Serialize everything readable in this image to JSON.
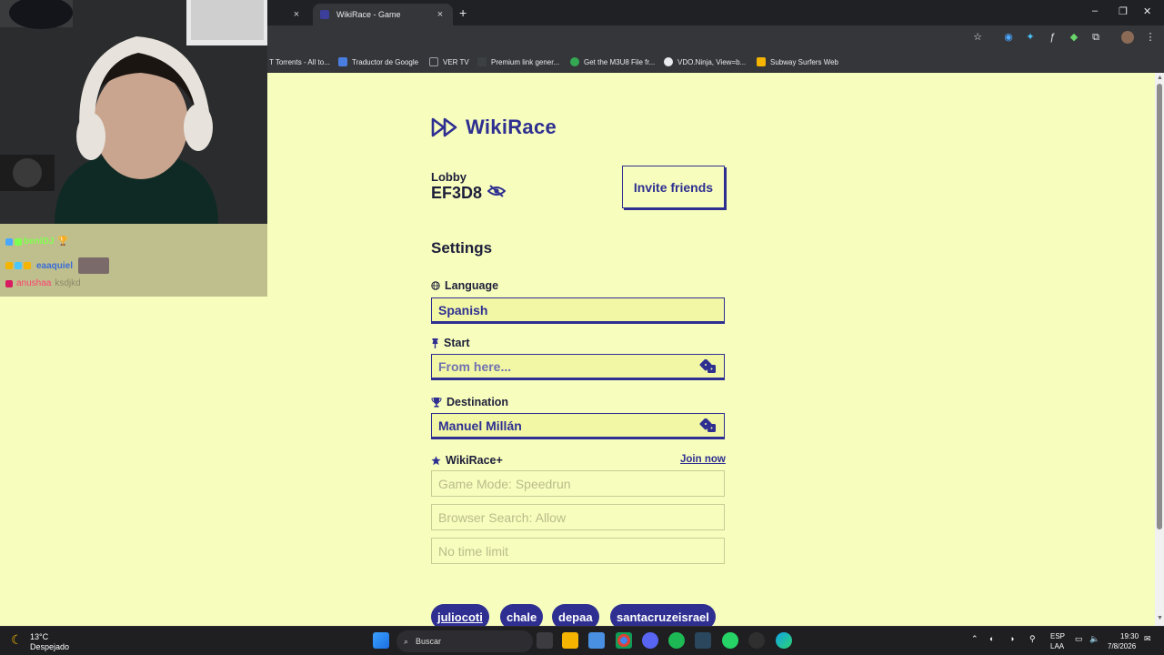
{
  "browser": {
    "tabs": [
      {
        "label": "",
        "active": false
      },
      {
        "label": "WikiRace - Game",
        "active": true
      }
    ],
    "new_tab": "+",
    "close": "×",
    "window_controls": {
      "minimize": "–",
      "maximize": "❐",
      "close": "✕"
    },
    "toolbar_icons": [
      "star-icon",
      "extension-icon",
      "extension-icon",
      "extension-icon",
      "extension-icon",
      "puzzle-icon",
      "avatar",
      "menu-icon"
    ],
    "bookmarks": [
      {
        "label": "T Torrents - All to...",
        "color": "#3a3a3a"
      },
      {
        "label": "Traductor de Google",
        "color": "#4a7de0"
      },
      {
        "label": "VER TV",
        "color": "#9aa0a6"
      },
      {
        "label": "Premium link gener...",
        "color": "#3c4043"
      },
      {
        "label": "Get the M3U8 File fr...",
        "color": "#34a853"
      },
      {
        "label": "VDO.Ninja, View=b...",
        "color": "#e8eaed"
      },
      {
        "label": "Subway Surfers Web",
        "color": "#f4b400"
      }
    ]
  },
  "app": {
    "brand": "WikiRace",
    "lobby_label": "Lobby",
    "lobby_code": "EF3D8",
    "invite_label": "Invite friends",
    "settings_title": "Settings",
    "language": {
      "label": "Language",
      "value": "Spanish"
    },
    "start": {
      "label": "Start",
      "placeholder": "From here...",
      "value": ""
    },
    "destination": {
      "label": "Destination",
      "value": "Manuel Millán"
    },
    "wikirace_plus": {
      "label": "WikiRace+",
      "join": "Join now"
    },
    "plus_options": [
      "Game Mode: Speedrun",
      "Browser Search: Allow",
      "No time limit"
    ],
    "players": [
      "juliocoti",
      "chale",
      "depaa",
      "santacruzeisrael"
    ],
    "colors": {
      "background": "#f7fdbd",
      "accent": "#2e2f91",
      "field_bg": "#f2f7a6"
    }
  },
  "chat": [
    {
      "user": "beniDJ",
      "text": "",
      "color": "#7fff4f"
    },
    {
      "user": "eaaquiel",
      "text": "",
      "color": "#3a6bd6"
    },
    {
      "user": "anushaa",
      "text": "ksdjkd",
      "color": "#ff3f6e"
    }
  ],
  "taskbar": {
    "weather_temp": "13°C",
    "weather_desc": "Despejado",
    "search_label": "Buscar",
    "lang_top": "ESP",
    "lang_bottom": "LAA",
    "time": "19:30",
    "date": "7/8/2026"
  }
}
